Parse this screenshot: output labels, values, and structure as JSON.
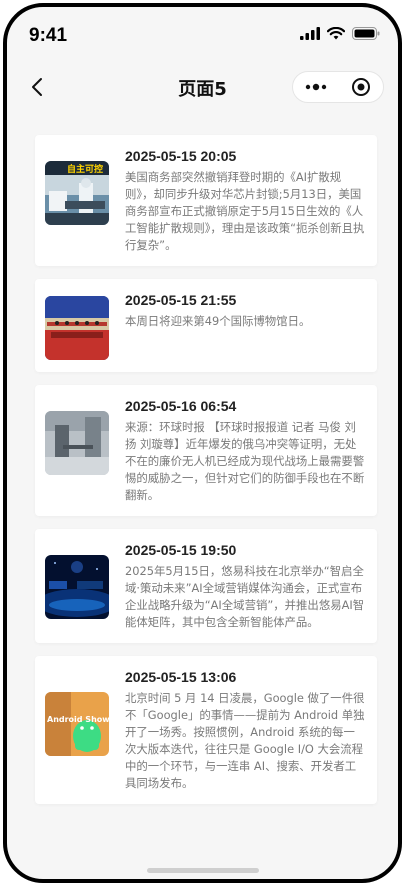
{
  "status": {
    "time": "9:41"
  },
  "nav": {
    "title": "页面5"
  },
  "news": [
    {
      "date": "2025-05-15 20:05",
      "text": "美国商务部突然撤销拜登时期的《AI扩散规则》，却同步升级对华芯片封锁;5月13日，美国商务部宣布正式撤销原定于5月15日生效的《人工智能扩散规则》，理由是该政策“扼杀创新且执行复杂”。",
      "thumb_caption": "自主可控"
    },
    {
      "date": "2025-05-15 21:55",
      "text": "本周日将迎来第49个国际博物馆日。"
    },
    {
      "date": "2025-05-16 06:54",
      "text": "来源：环球时报 【环球时报报道 记者 马俊 刘扬 刘璇尊】近年爆发的俄乌冲突等证明，无处不在的廉价无人机已经成为现代战场上最需要警惕的威胁之一，但针对它们的防御手段也在不断翻新。"
    },
    {
      "date": "2025-05-15 19:50",
      "text": "2025年5月15日，悠易科技在北京举办“智启全域·策动未来”AI全域营销媒体沟通会，正式宣布企业战略升级为“AI全域营销”，并推出悠易AI智能体矩阵，其中包含全新智能体产品。"
    },
    {
      "date": "2025-05-15 13:06",
      "text": "北京时间 5 月 14 日凌晨，Google 做了一件很不「Google」的事情——提前为 Android 单独开了一场秀。按照惯例，Android 系统的每一次大版本迭代，往往只是 Google I/O 大会流程中的一个环节，与一连串 AI、搜索、开发者工具同场发布。",
      "thumb_caption": "Android Show"
    }
  ]
}
